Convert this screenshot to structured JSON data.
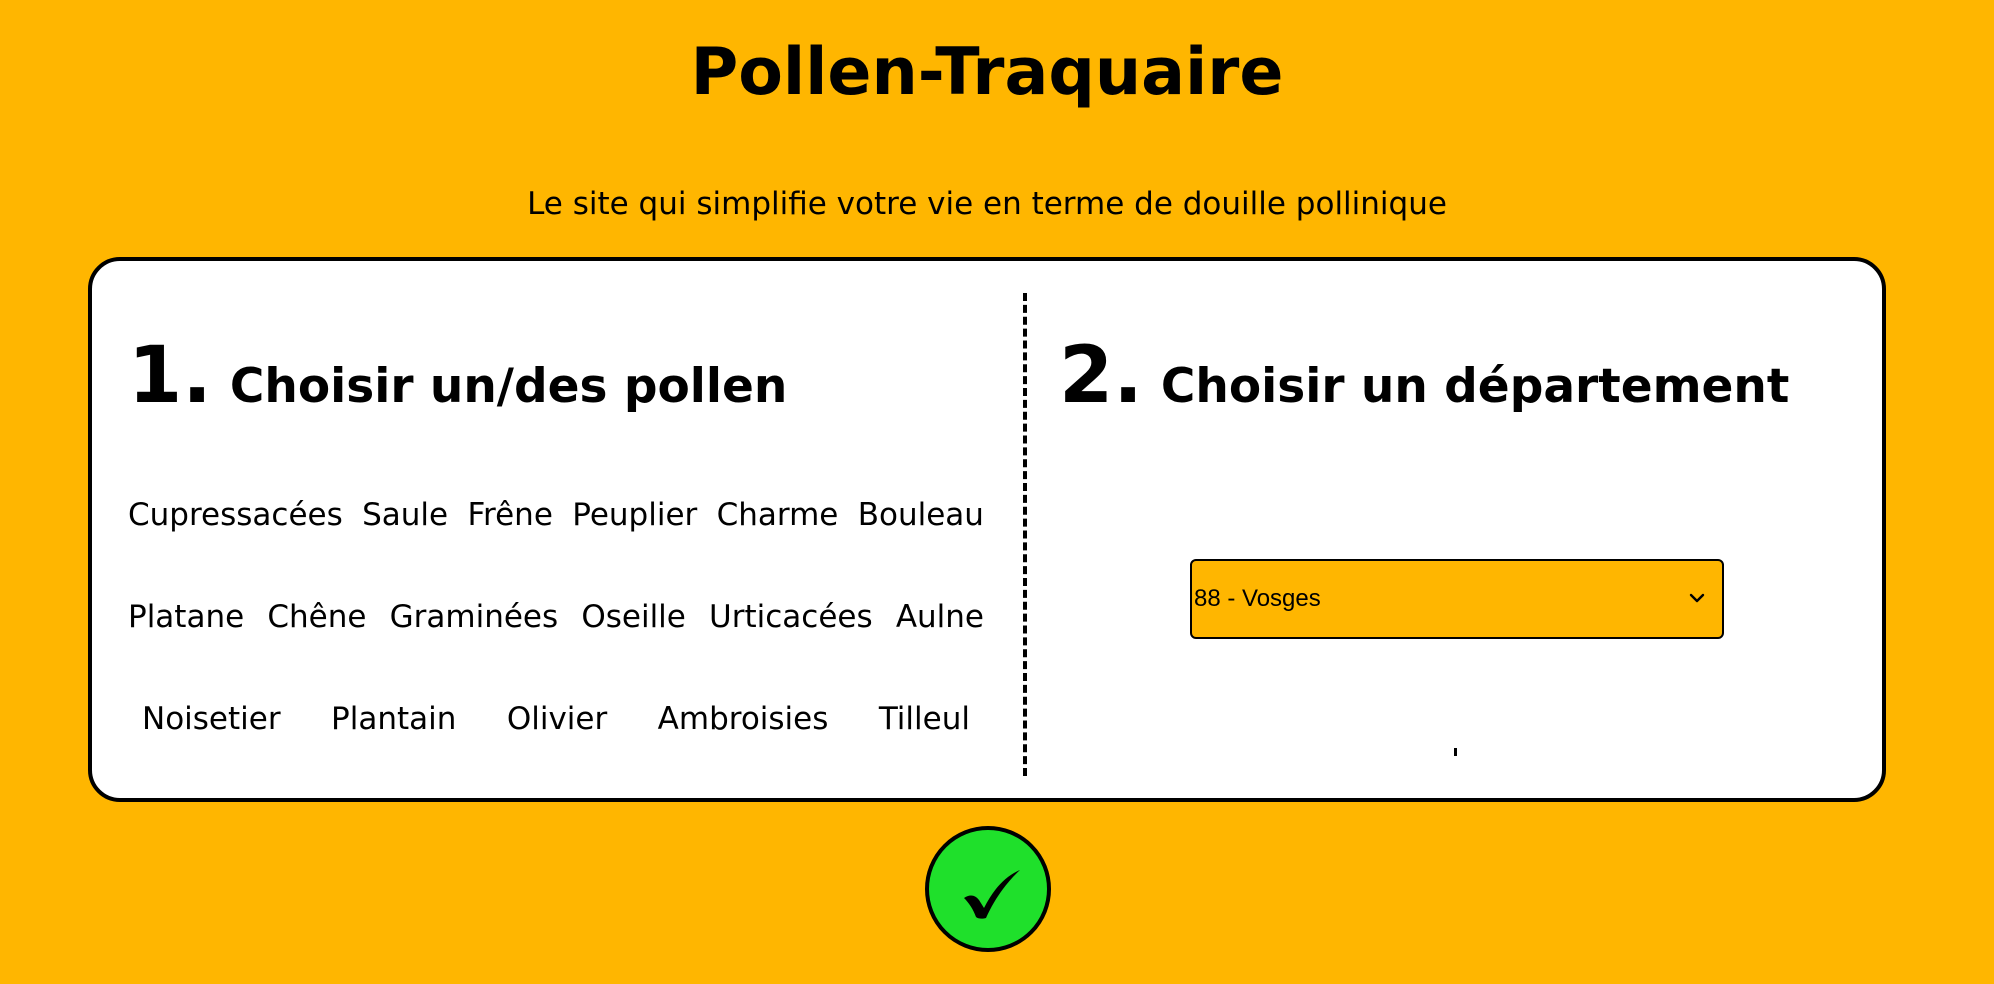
{
  "header": {
    "title": "Pollen-Traquaire",
    "subtitle": "Le site qui simplifie votre vie en terme de douille pollinique"
  },
  "step1": {
    "number": "1.",
    "label": "Choisir un/des pollen",
    "pollens": [
      [
        "Cupressacées",
        "Saule",
        "Frêne",
        "Peuplier",
        "Charme",
        "Bouleau"
      ],
      [
        "Platane",
        "Chêne",
        "Graminées",
        "Oseille",
        "Urticacées",
        "Aulne"
      ],
      [
        "Noisetier",
        "Plantain",
        "Olivier",
        "Ambroisies",
        "Tilleul"
      ]
    ]
  },
  "step2": {
    "number": "2.",
    "label": "Choisir un département",
    "department_select": {
      "selected": "88 - Vosges"
    }
  },
  "submit": {
    "icon": "checkmark-icon",
    "color": "#1FE02B"
  },
  "colors": {
    "background": "#FFB600",
    "card": "#FFFFFF"
  }
}
